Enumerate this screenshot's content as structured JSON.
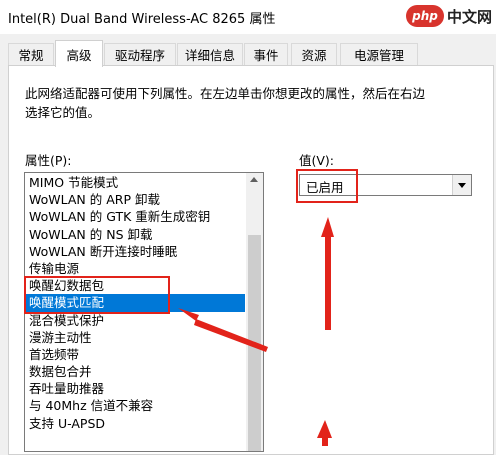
{
  "window": {
    "title": "Intel(R) Dual Band Wireless-AC 8265 属性"
  },
  "watermark": {
    "logo_text": "php",
    "site_text": "中文网"
  },
  "tabs": [
    {
      "label": "常规",
      "active": false
    },
    {
      "label": "高级",
      "active": true
    },
    {
      "label": "驱动程序",
      "active": false
    },
    {
      "label": "详细信息",
      "active": false
    },
    {
      "label": "事件",
      "active": false
    },
    {
      "label": "资源",
      "active": false
    },
    {
      "label": "电源管理",
      "active": false
    }
  ],
  "panel": {
    "description": "此网络适配器可使用下列属性。在左边单击你想更改的属性，然后在右边选择它的值。",
    "property_label": "属性(P):",
    "value_label": "值(V):",
    "value_selected": "已启用"
  },
  "properties": [
    "MIMO 节能模式",
    "WoWLAN 的 ARP 卸载",
    "WoWLAN 的 GTK 重新生成密钥",
    "WoWLAN 的 NS 卸载",
    "WoWLAN 断开连接时睡眠",
    "传输电源",
    "唤醒幻数据包",
    "唤醒模式匹配",
    "混合模式保护",
    "漫游主动性",
    "首选频带",
    "数据包合并",
    "吞吐量助推器",
    "与 40Mhz 信道不兼容",
    "支持 U-APSD"
  ],
  "selected_property": "唤醒模式匹配",
  "colors": {
    "selection": "#0078d7",
    "annotation": "#e2231a"
  }
}
